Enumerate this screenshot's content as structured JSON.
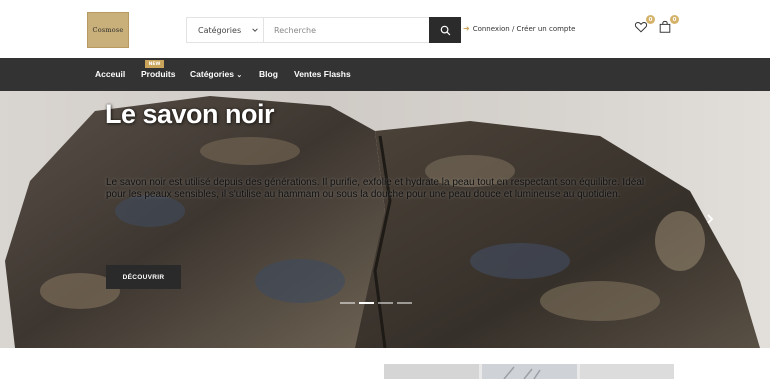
{
  "header": {
    "logo_text": "Cosmose",
    "search": {
      "category_label": "Catégories",
      "placeholder": "Recherche"
    },
    "login_label": "Connexion / Créer un compte",
    "wishlist_count": "0",
    "cart_count": "0"
  },
  "nav": {
    "items": [
      {
        "label": "Acceuil"
      },
      {
        "label": "Produits",
        "tag": "NEW"
      },
      {
        "label": "Catégories"
      },
      {
        "label": "Blog"
      },
      {
        "label": "Ventes Flashs"
      }
    ]
  },
  "hero": {
    "title": "Le savon noir",
    "description": "Le savon noir est utilisé depuis des générations. Il purifie, exfolie et hydrate la peau tout en respectant son équilibre. Idéal pour les peaux sensibles, il s'utilise au hammam ou sous la douche pour une peau douce et lumineuse au quotidien.",
    "button_label": "DÉCOUVRIR",
    "slides_total": 4,
    "active_slide": 2
  },
  "colors": {
    "accent": "#c9a45a",
    "nav_bg": "#333333",
    "button_dark": "#2b2b2b"
  }
}
